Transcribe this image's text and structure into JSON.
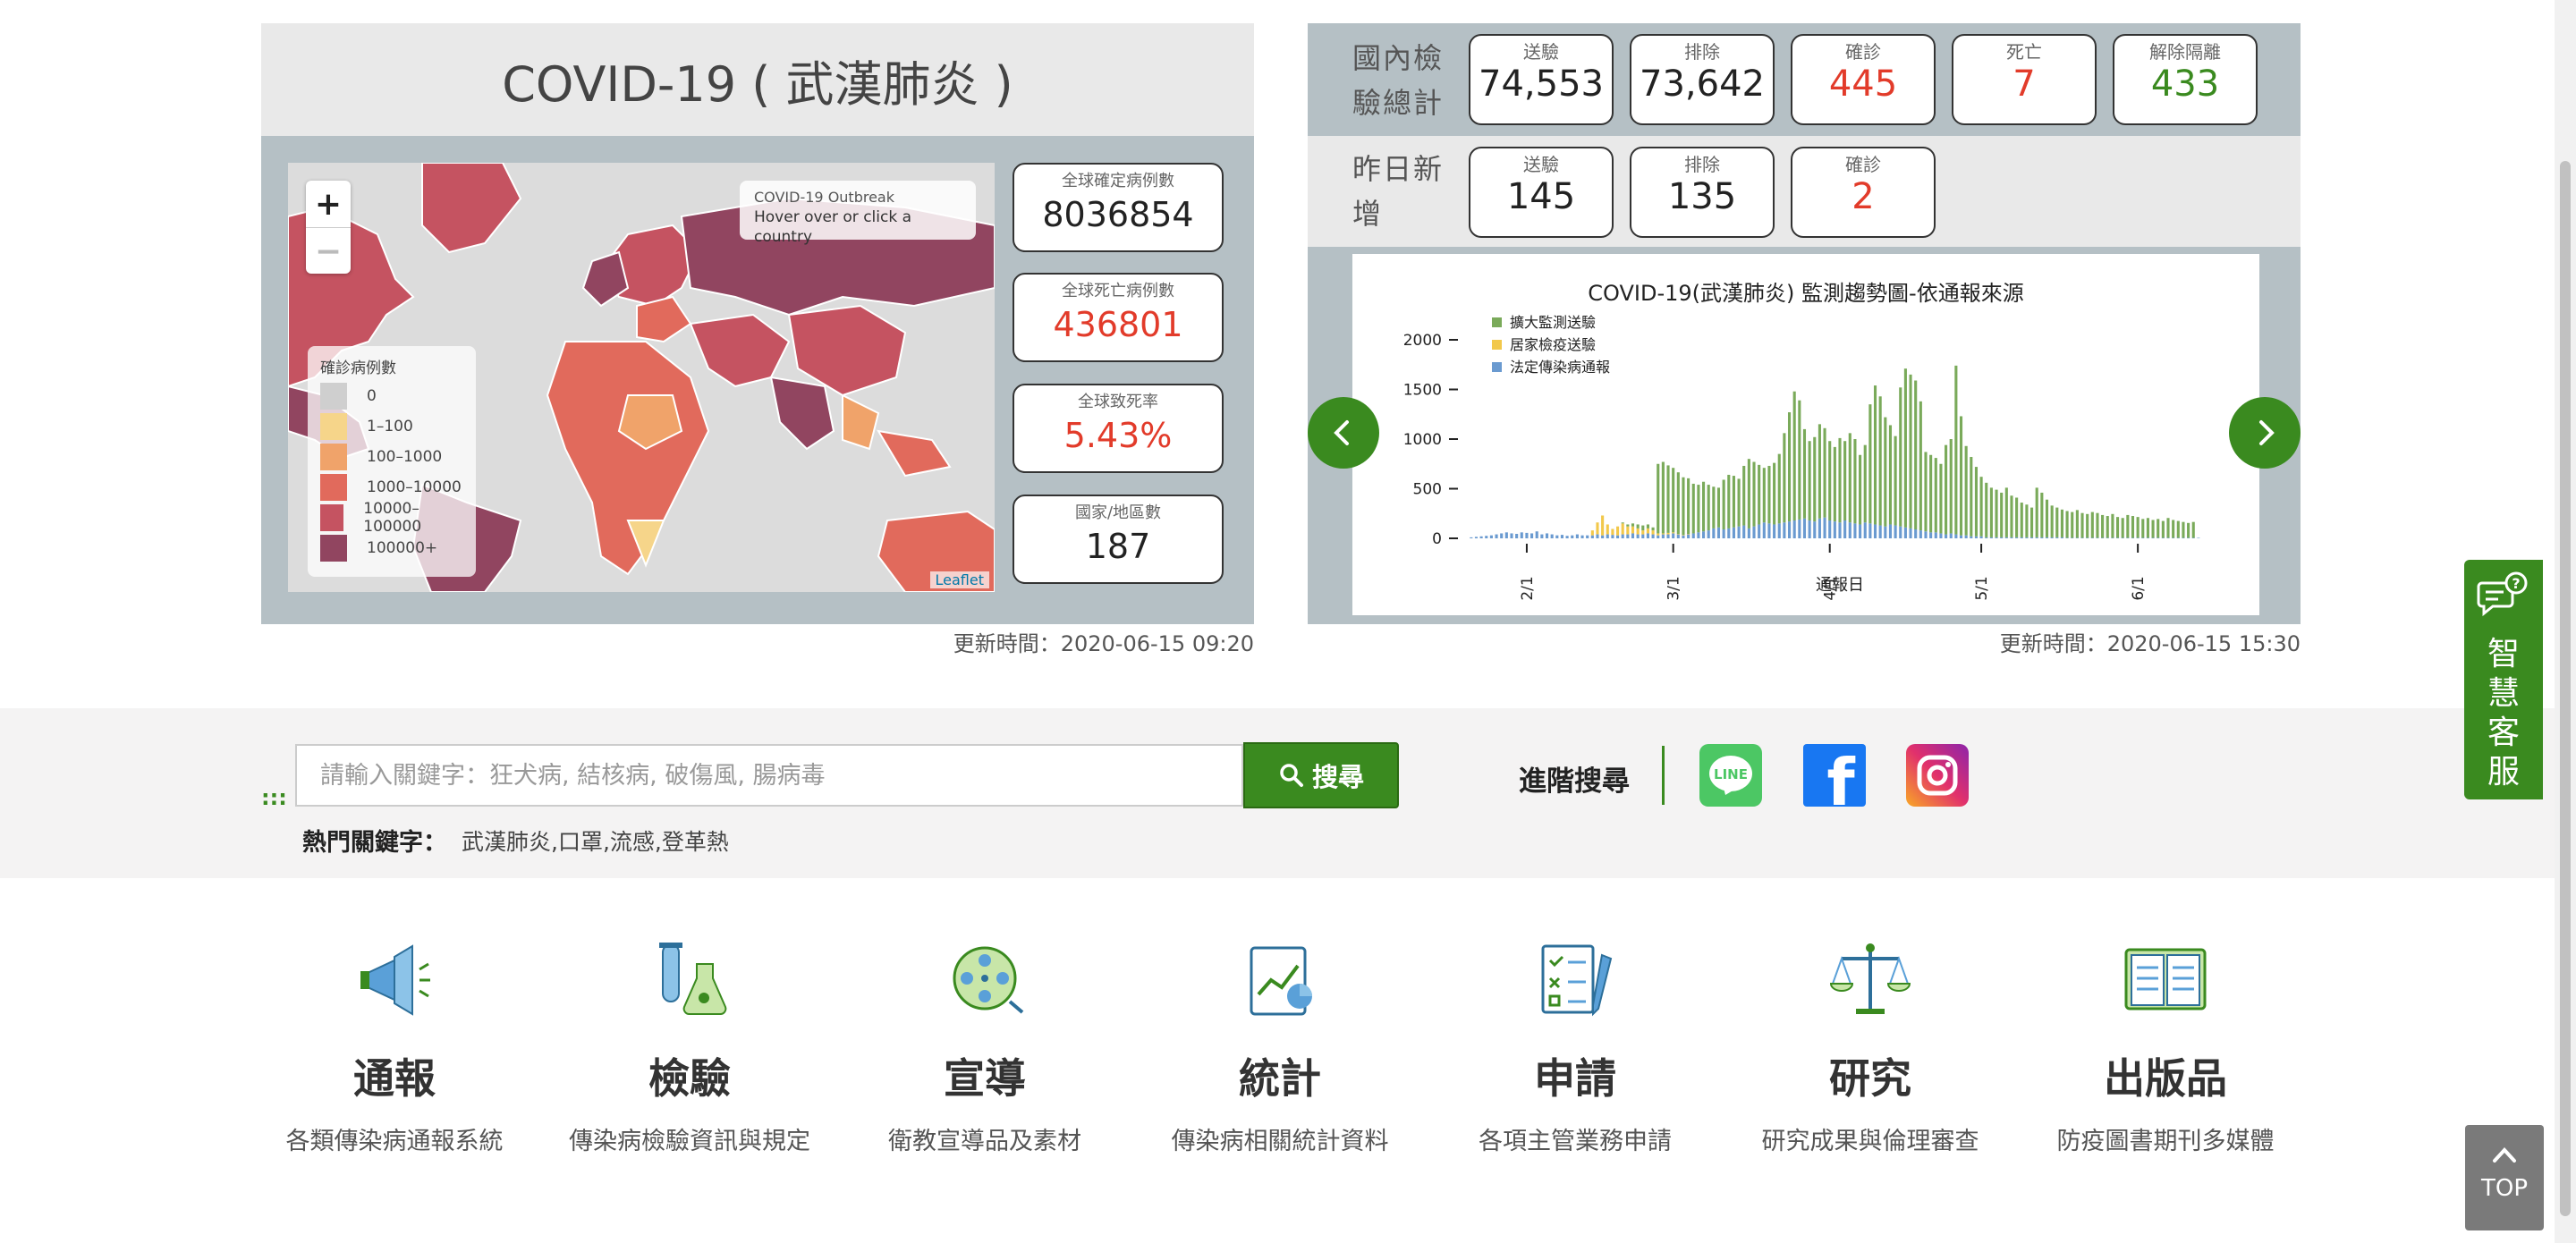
{
  "map_panel": {
    "title": "COVID-19 ( 武漢肺炎 )",
    "zoom_in": "+",
    "zoom_out": "−",
    "info_title": "COVID-19 Outbreak",
    "info_text": "Hover over or click a country",
    "legend_title": "確診病例數",
    "legend": [
      {
        "label": "0",
        "color": "#cfcfcf"
      },
      {
        "label": "1–100",
        "color": "#f6d58a"
      },
      {
        "label": "100–1000",
        "color": "#f0a36a"
      },
      {
        "label": "1000–10000",
        "color": "#e16a5c"
      },
      {
        "label": "10000–100000",
        "color": "#c55361"
      },
      {
        "label": "100000+",
        "color": "#914560"
      }
    ],
    "attribution": "Leaflet",
    "stats": [
      {
        "label": "全球確定病例數",
        "value": "8036854",
        "color": "normal"
      },
      {
        "label": "全球死亡病例數",
        "value": "436801",
        "color": "red"
      },
      {
        "label": "全球致死率",
        "value": "5.43%",
        "color": "red"
      },
      {
        "label": "國家/地區數",
        "value": "187",
        "color": "normal"
      }
    ],
    "update_time": "更新時間：2020-06-15 09:20"
  },
  "domestic_panel": {
    "row1_label": "國內檢驗總計",
    "row1": [
      {
        "label": "送驗",
        "value": "74,553",
        "color": "normal"
      },
      {
        "label": "排除",
        "value": "73,642",
        "color": "normal"
      },
      {
        "label": "確診",
        "value": "445",
        "color": "red"
      },
      {
        "label": "死亡",
        "value": "7",
        "color": "red"
      },
      {
        "label": "解除隔離",
        "value": "433",
        "color": "green"
      }
    ],
    "row2_label": "昨日新增",
    "row2": [
      {
        "label": "送驗",
        "value": "145",
        "color": "normal"
      },
      {
        "label": "排除",
        "value": "135",
        "color": "normal"
      },
      {
        "label": "確診",
        "value": "2",
        "color": "red"
      }
    ],
    "update_time": "更新時間：2020-06-15 15:30"
  },
  "chart_data": {
    "type": "bar",
    "title": "COVID-19(武漢肺炎) 監測趨勢圖-依通報來源",
    "xlabel": "通報日",
    "ylabel": "",
    "ylim": [
      0,
      2000
    ],
    "yticks": [
      "0",
      "500",
      "1000",
      "1500",
      "2000"
    ],
    "xticks": [
      {
        "label": "2/1",
        "index": 11
      },
      {
        "label": "3/1",
        "index": 40
      },
      {
        "label": "4/1",
        "index": 71
      },
      {
        "label": "5/1",
        "index": 101
      },
      {
        "label": "6/1",
        "index": 132
      }
    ],
    "series": [
      {
        "name": "擴大監測送驗",
        "color": "#7aaa5a",
        "values": [
          0,
          0,
          0,
          0,
          0,
          0,
          0,
          0,
          0,
          0,
          0,
          0,
          0,
          0,
          0,
          0,
          0,
          0,
          0,
          0,
          0,
          0,
          0,
          0,
          0,
          0,
          0,
          0,
          0,
          0,
          10,
          20,
          30,
          40,
          50,
          40,
          30,
          700,
          720,
          680,
          650,
          620,
          580,
          560,
          500,
          480,
          500,
          460,
          420,
          400,
          500,
          540,
          520,
          480,
          600,
          700,
          650,
          600,
          550,
          580,
          620,
          700,
          900,
          1100,
          1300,
          1200,
          900,
          800,
          850,
          950,
          900,
          800,
          750,
          850,
          800,
          900,
          850,
          700,
          780,
          1200,
          1400,
          1300,
          1100,
          1000,
          900,
          1400,
          1600,
          1550,
          1500,
          1300,
          800,
          780,
          750,
          700,
          900,
          950,
          1700,
          1200,
          900,
          800,
          700,
          600,
          550,
          500,
          480,
          450,
          500,
          420,
          400,
          350,
          330,
          300,
          500,
          450,
          380,
          320,
          300,
          280,
          270,
          260,
          280,
          250,
          240,
          260,
          250,
          230,
          220,
          240,
          210,
          200,
          230,
          220,
          210,
          190,
          200,
          180,
          190,
          170,
          200,
          180,
          170,
          160,
          150,
          160,
          140,
          150,
          130
        ]
      },
      {
        "name": "居家檢疫送驗",
        "color": "#f2c84b",
        "values": [
          0,
          0,
          0,
          0,
          0,
          0,
          0,
          0,
          0,
          0,
          0,
          0,
          0,
          0,
          0,
          0,
          0,
          0,
          0,
          0,
          0,
          0,
          0,
          0,
          50,
          120,
          200,
          100,
          60,
          90,
          110,
          80,
          70,
          60,
          40,
          50,
          40,
          20,
          10,
          15,
          10,
          5,
          5,
          5,
          0,
          0,
          0,
          0,
          0,
          0,
          0,
          0,
          0,
          0,
          0,
          0,
          0,
          0,
          0,
          0,
          0,
          0,
          0,
          0,
          0,
          0,
          0,
          0,
          0,
          0,
          0,
          0,
          0,
          0,
          0,
          0,
          0,
          0,
          0,
          0,
          0,
          0,
          0,
          0,
          0,
          0,
          0,
          0,
          0,
          0,
          0,
          0,
          0,
          0,
          0,
          0,
          0,
          0,
          0,
          0,
          0,
          0,
          0,
          0,
          0,
          0,
          0,
          0,
          0,
          0,
          0,
          0,
          0,
          0,
          0,
          0,
          0,
          0,
          0,
          0,
          0,
          0,
          0,
          0,
          0,
          0,
          0,
          0,
          0,
          0,
          0,
          0,
          0,
          0,
          0,
          0,
          0,
          0,
          0,
          0,
          0,
          0,
          0,
          0
        ]
      },
      {
        "name": "法定傳染病通報",
        "color": "#6a9ad0",
        "values": [
          10,
          15,
          20,
          25,
          30,
          40,
          50,
          60,
          50,
          45,
          60,
          55,
          50,
          70,
          40,
          50,
          40,
          30,
          35,
          25,
          30,
          40,
          30,
          30,
          30,
          40,
          30,
          40,
          35,
          30,
          40,
          40,
          50,
          40,
          40,
          50,
          40,
          30,
          40,
          40,
          50,
          40,
          30,
          40,
          50,
          60,
          70,
          80,
          100,
          110,
          90,
          100,
          110,
          120,
          130,
          100,
          120,
          140,
          160,
          150,
          140,
          150,
          160,
          170,
          180,
          190,
          200,
          180,
          170,
          200,
          210,
          180,
          170,
          160,
          180,
          160,
          150,
          140,
          160,
          150,
          140,
          130,
          120,
          140,
          130,
          120,
          110,
          100,
          90,
          80,
          70,
          60,
          60,
          50,
          40,
          50,
          40,
          30,
          30,
          20,
          20,
          20,
          10,
          10,
          10,
          10,
          10,
          10,
          10,
          10,
          10,
          10,
          10,
          10,
          10,
          10,
          10,
          10,
          5,
          5,
          5,
          5,
          5,
          5,
          5,
          5,
          5,
          5,
          5,
          5,
          5,
          5,
          5,
          5,
          5,
          5,
          5,
          5,
          5,
          5,
          5,
          5,
          5,
          5,
          5
        ]
      }
    ],
    "legend_position": "top-left"
  },
  "search": {
    "placeholder": "請輸入關鍵字：狂犬病, 結核病, 破傷風, 腸病毒",
    "button_label": "搜尋",
    "hot_label": "熱門關鍵字：",
    "hot_words": "武漢肺炎,口罩,流感,登革熱",
    "advanced_label": "進階搜尋",
    "dots": ":::"
  },
  "social": [
    {
      "name": "line-icon",
      "label": "LINE",
      "color": "#4cc764"
    },
    {
      "name": "facebook-icon",
      "label": "f",
      "color": "#1877f2"
    },
    {
      "name": "instagram-icon",
      "label": "",
      "color": "#d6249f"
    }
  ],
  "services": [
    {
      "id": "report",
      "name": "通報",
      "desc": "各類傳染病通報系統",
      "icon": "megaphone-icon"
    },
    {
      "id": "test",
      "name": "檢驗",
      "desc": "傳染病檢驗資訊與規定",
      "icon": "lab-flask-icon"
    },
    {
      "id": "promo",
      "name": "宣導",
      "desc": "衛教宣導品及素材",
      "icon": "film-reel-icon"
    },
    {
      "id": "stats",
      "name": "統計",
      "desc": "傳染病相關統計資料",
      "icon": "chart-doc-icon"
    },
    {
      "id": "apply",
      "name": "申請",
      "desc": "各項主管業務申請",
      "icon": "checklist-pen-icon"
    },
    {
      "id": "research",
      "name": "研究",
      "desc": "研究成果與倫理審查",
      "icon": "scales-icon"
    },
    {
      "id": "publication",
      "name": "出版品",
      "desc": "防疫圖書期刊多媒體",
      "icon": "open-book-icon"
    }
  ],
  "chat_widget": {
    "text": "智慧客服"
  },
  "top_button": {
    "label": "TOP"
  },
  "colors": {
    "accent_green": "#3a8a1f",
    "red": "#e23b2a",
    "panel_gray": "#b5c0c5"
  }
}
